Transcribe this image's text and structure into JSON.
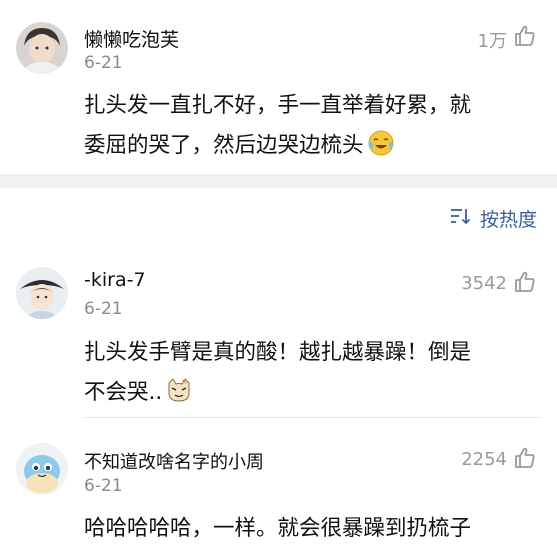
{
  "comments": [
    {
      "name": "懒懒吃泡芙",
      "date": "6-21",
      "likes": "1万",
      "text_lines": [
        "扎头发一直扎不好，手一直举着好累，就",
        "委屈的哭了，然后边哭边梳头"
      ],
      "emoji": "crying-laughing-emoji"
    },
    {
      "name": "-kira-7",
      "date": "6-21",
      "likes": "3542",
      "text_lines": [
        "扎头发手臂是真的酸！越扎越暴躁！倒是",
        "不会哭.."
      ],
      "emoji": "cat-face-emoji"
    },
    {
      "name": "不知道改啥名字的小周",
      "date": "6-21",
      "likes": "2254",
      "text_lines": [
        "哈哈哈哈哈，一样。就会很暴躁到扔梳子"
      ]
    }
  ],
  "sort": {
    "label": "按热度",
    "icon": "sort-icon"
  },
  "colors": {
    "link": "#3a5f9a",
    "meta": "#8a8a8a",
    "divider": "#f1f1f1"
  }
}
